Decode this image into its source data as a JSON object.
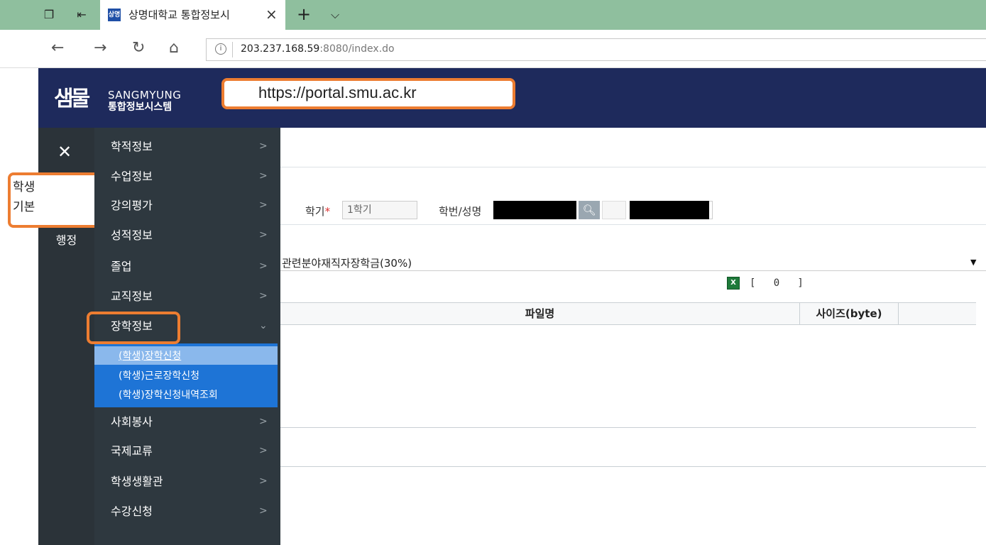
{
  "browser": {
    "tab_title": "상명대학교 통합정보시",
    "tab_favicon": "상명",
    "url_host": "203.237.168.59",
    "url_rest": ":8080/index.do"
  },
  "header": {
    "logo_mark": "샘물",
    "logo_en": "SANGMYUNG",
    "logo_ko": "통합정보시스템",
    "url_callout": "https://portal.smu.ac.kr"
  },
  "leftbar": {
    "items": [
      "학생",
      "기본",
      "행정"
    ]
  },
  "menu": {
    "items": [
      {
        "label": "학적정보",
        "arrow": ">"
      },
      {
        "label": "수업정보",
        "arrow": ">"
      },
      {
        "label": "강의평가",
        "arrow": ">"
      },
      {
        "label": "성적정보",
        "arrow": ">"
      },
      {
        "label": "졸업",
        "arrow": ">"
      },
      {
        "label": "교직정보",
        "arrow": ">"
      },
      {
        "label": "장학정보",
        "arrow": "⌄"
      },
      {
        "label": "사회봉사",
        "arrow": ">"
      },
      {
        "label": "국제교류",
        "arrow": ">"
      },
      {
        "label": "학생생활관",
        "arrow": ">"
      },
      {
        "label": "수강신청",
        "arrow": ">"
      }
    ],
    "sub_items": [
      {
        "label": "(학생)장학신청"
      },
      {
        "label": "(학생)근로장학신청"
      },
      {
        "label": "(학생)장학신청내역조회"
      }
    ]
  },
  "form": {
    "semester_label": "학기",
    "semester_required": "*",
    "semester_value": "1학기",
    "student_label": "학번/성명"
  },
  "scholarship": {
    "selected": "관련분야재직자장학금(30%)"
  },
  "files": {
    "count_text": "[   0   ]",
    "col_file": "파일명",
    "col_size": "사이즈(byte)"
  },
  "colors": {
    "header_bg": "#1e2a5c",
    "menu_bg": "#2e383f",
    "submenu_bg": "#1e74d6",
    "callout": "#ed7d31",
    "tab_strip": "#8fbf9e"
  }
}
